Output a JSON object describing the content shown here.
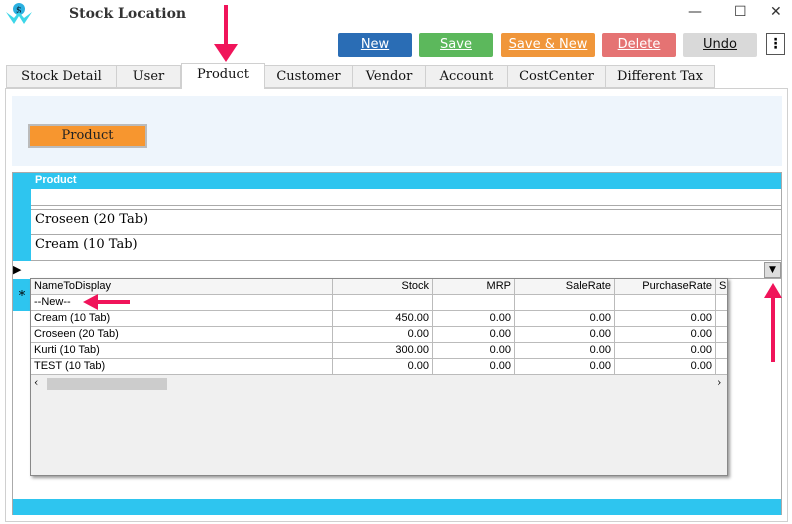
{
  "window": {
    "title": "Stock Location",
    "minimize": "—",
    "maximize": "☐",
    "close": "✕"
  },
  "toolbar": {
    "new": "New",
    "save": "Save",
    "save_new": "Save & New",
    "delete": "Delete",
    "undo": "Undo",
    "more": "⋮",
    "colors": {
      "new": "#2a6db5",
      "save": "#5cb85c",
      "save_new": "#f0963a",
      "delete": "#e57373",
      "undo": "#d9d9d9"
    }
  },
  "tabs": [
    "Stock Detail",
    "User",
    "Product",
    "Customer",
    "Vendor",
    "Account",
    "CostCenter",
    "Different Tax"
  ],
  "selected_tab": "Product",
  "product_button": "Product",
  "grid": {
    "header": "Product",
    "rows": [
      "",
      "Croseen (20 Tab)",
      "Cream (10 Tab)",
      ""
    ]
  },
  "dropdown": {
    "columns": [
      "NameToDisplay",
      "Stock",
      "MRP",
      "SaleRate",
      "PurchaseRate",
      "Sh"
    ],
    "rows": [
      [
        "--New--",
        "",
        "",
        "",
        ""
      ],
      [
        "Cream (10 Tab)",
        "450.00",
        "0.00",
        "0.00",
        "0.00"
      ],
      [
        "Croseen (20 Tab)",
        "0.00",
        "0.00",
        "0.00",
        "0.00"
      ],
      [
        "Kurti (10 Tab)",
        "300.00",
        "0.00",
        "0.00",
        "0.00"
      ],
      [
        "TEST (10 Tab)",
        "0.00",
        "0.00",
        "0.00",
        "0.00"
      ]
    ]
  },
  "accent": "#2ec5ef",
  "annotation_color": "#f0145a"
}
